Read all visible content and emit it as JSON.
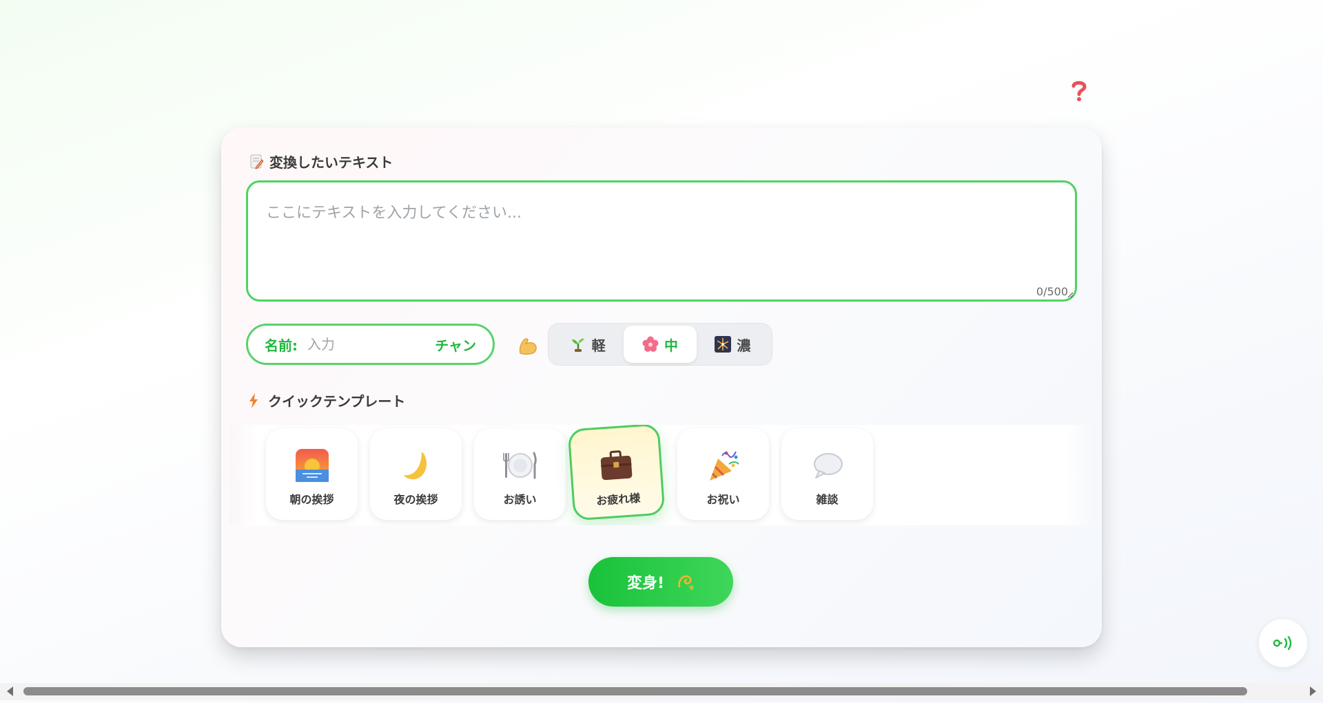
{
  "help": {
    "icon": "question-icon"
  },
  "input_section": {
    "label": "変換したいテキスト",
    "icon": "memo-icon",
    "placeholder": "ここにテキストを入力してください...",
    "char_count": "0/500"
  },
  "name_field": {
    "label": "名前:",
    "placeholder": "入力",
    "suffix": "チャン"
  },
  "intensity": {
    "icon": "flexed-biceps-icon",
    "options": [
      {
        "label": "軽",
        "icon": "seedling-icon",
        "active": false
      },
      {
        "label": "中",
        "icon": "cherry-blossom-icon",
        "active": true
      },
      {
        "label": "濃",
        "icon": "fireworks-icon",
        "active": false
      }
    ]
  },
  "templates": {
    "title": "クイックテンプレート",
    "icon": "lightning-icon",
    "items": [
      {
        "label": "朝の挨拶",
        "icon": "sunrise-icon",
        "selected": false
      },
      {
        "label": "夜の挨拶",
        "icon": "crescent-moon-icon",
        "selected": false
      },
      {
        "label": "お誘い",
        "icon": "plate-cutlery-icon",
        "selected": false
      },
      {
        "label": "お疲れ様",
        "icon": "briefcase-icon",
        "selected": true
      },
      {
        "label": "お祝い",
        "icon": "party-popper-icon",
        "selected": false
      },
      {
        "label": "雑談",
        "icon": "speech-bubble-icon",
        "selected": false
      }
    ]
  },
  "submit": {
    "label": "変身!",
    "icon": "dizzy-icon"
  },
  "floating": {
    "icon": "broadcast-icon"
  },
  "colors": {
    "accent": "#4cd362",
    "accent_text": "#1fb83e",
    "help": "#e8505b"
  }
}
